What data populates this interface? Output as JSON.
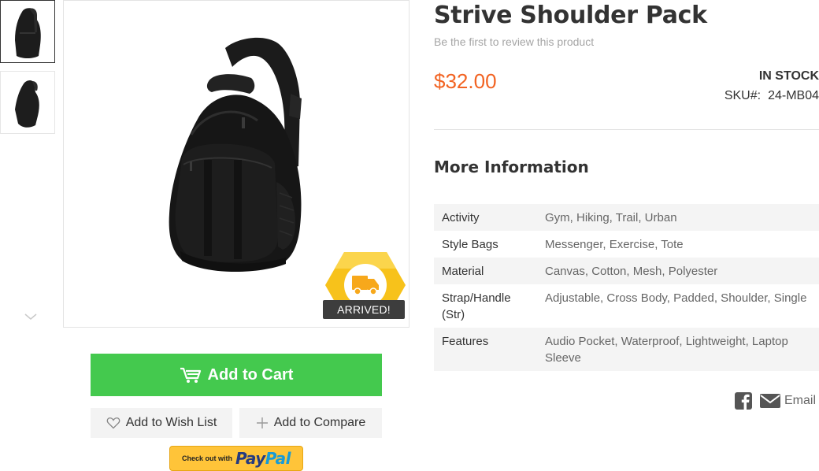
{
  "product": {
    "title": "Strive Shoulder Pack",
    "review_link": "Be the first to review this product",
    "price": "$32.00",
    "stock": "IN STOCK",
    "sku_label": "SKU#:",
    "sku_value": "24-MB04"
  },
  "gallery": {
    "badge_label": "ARRIVED!",
    "icons": {
      "thumb_down": "chevron-down-icon",
      "badge": "delivery-truck-icon"
    }
  },
  "actions": {
    "add_to_cart": "Add to Cart",
    "add_to_wish_list": "Add to Wish List",
    "add_to_compare": "Add to Compare",
    "paypal_prefix": "Check out with",
    "paypal_pay": "Pay",
    "paypal_pal": "Pal"
  },
  "more_info": {
    "title": "More Information",
    "rows": [
      {
        "label": "Activity",
        "value": "Gym, Hiking, Trail, Urban"
      },
      {
        "label": "Style Bags",
        "value": "Messenger, Exercise, Tote"
      },
      {
        "label": "Material",
        "value": "Canvas, Cotton, Mesh, Polyester"
      },
      {
        "label": "Strap/Handle (Str)",
        "value": "Adjustable, Cross Body, Padded, Shoulder, Single"
      },
      {
        "label": "Features",
        "value": "Audio Pocket, Waterproof, Lightweight, Laptop Sleeve"
      }
    ]
  },
  "share": {
    "email_label": "Email"
  },
  "colors": {
    "price": "#f26322",
    "cart_button": "#44c94e",
    "badge_yellow": "#f7c21b",
    "paypal_yellow": "#ffc439"
  }
}
